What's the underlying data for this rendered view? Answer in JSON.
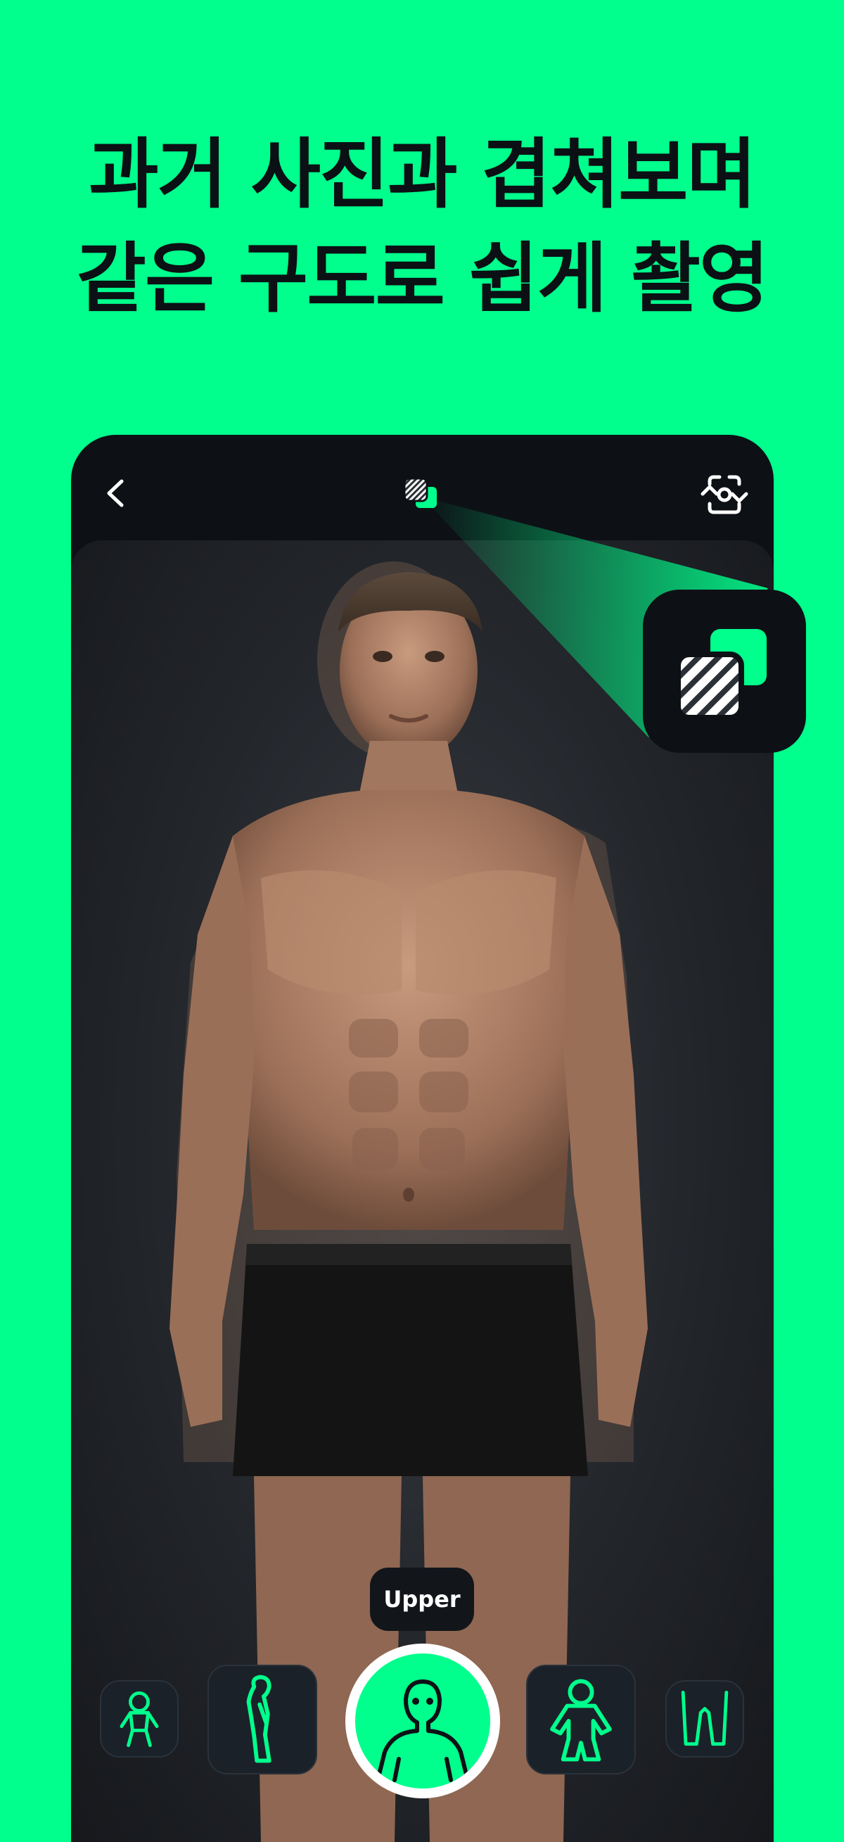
{
  "headline": {
    "line1": "과거 사진과 겹쳐보며",
    "line2": "같은 구도로 쉽게 촬영"
  },
  "topbar": {
    "back_icon": "chevron-left-icon",
    "overlay_icon": "overlay-layers-icon",
    "camera_flip_icon": "camera-flip-icon"
  },
  "pose_selector": {
    "selected_label": "Upper",
    "poses": [
      "full-body-front",
      "side-body",
      "upper-body",
      "upper-front",
      "legs"
    ],
    "selected": "upper-body"
  },
  "colors": {
    "accent": "#00FF8C",
    "dark": "#0D1116",
    "button_bg": "#1b2128"
  }
}
